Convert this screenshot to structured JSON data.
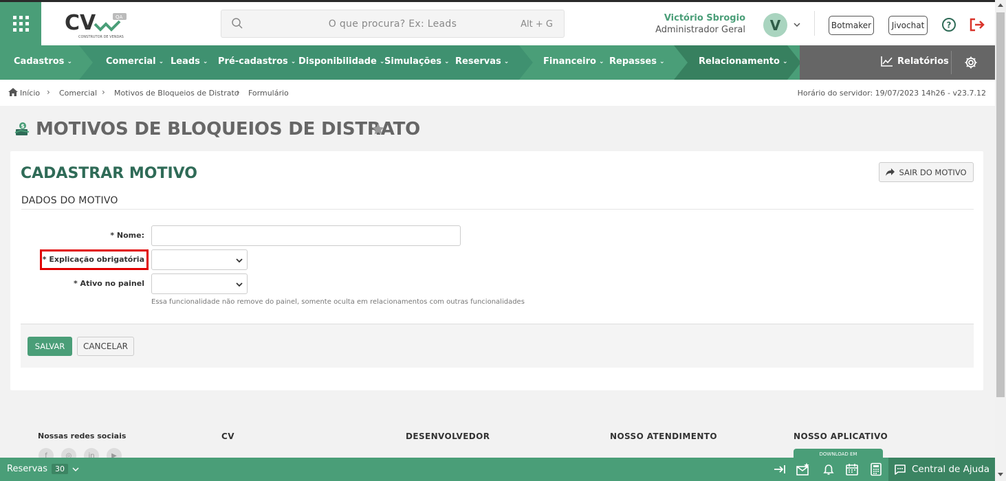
{
  "header": {
    "logo_text": "CV",
    "logo_tag": "QA",
    "logo_sub": "CONSTRUTOR DE VENDAS",
    "search_placeholder": "O que procura? Ex: Leads",
    "search_shortcut": "Alt + G",
    "user_name": "Victório Sbrogio",
    "user_role": "Administrador Geral",
    "avatar_initial": "V",
    "botmaker": "Botmaker",
    "jivochat": "Jivochat"
  },
  "nav": {
    "items": [
      {
        "label": "Cadastros"
      },
      {
        "label": "Comercial"
      },
      {
        "label": "Leads"
      },
      {
        "label": "Pré-cadastros"
      },
      {
        "label": "Disponibilidade"
      },
      {
        "label": "Simulações"
      },
      {
        "label": "Reservas"
      },
      {
        "label": "Financeiro"
      },
      {
        "label": "Repasses"
      },
      {
        "label": "Relacionamento"
      }
    ],
    "reports": "Relatórios",
    "caret": "⌄"
  },
  "breadcrumb": {
    "items": [
      "Início",
      "Comercial",
      "Motivos de Bloqueios de Distrato",
      "Formulário"
    ],
    "server_time": "Horário do servidor: 19/07/2023 14h26 - v23.7.12"
  },
  "page": {
    "title": "MOTIVOS DE BLOQUEIOS DE DISTRATO"
  },
  "form": {
    "card_title": "CADASTRAR MOTIVO",
    "exit_button": "SAIR DO MOTIVO",
    "section_title": "DADOS DO MOTIVO",
    "name_label": "* Nome:",
    "explanation_label": "* Explicação obrigatória",
    "active_label": "* Ativo no painel",
    "active_hint": "Essa funcionalidade não remove do painel, somente oculta em relacionamentos com outras funcionalidades",
    "save_button": "SALVAR",
    "cancel_button": "CANCELAR"
  },
  "footer": {
    "social_title": "Nossas redes sociais",
    "col_cv": "CV",
    "col_dev": "DESENVOLVEDOR",
    "col_support": "NOSSO ATENDIMENTO",
    "col_app": "NOSSO APLICATIVO",
    "app_badge": "DOWNLOAD EM"
  },
  "bottombar": {
    "reservas_label": "Reservas",
    "reservas_count": "30",
    "help_center": "Central de Ajuda"
  },
  "colors": {
    "brand_green": "#4a9e78",
    "dark_green": "#2f6b57",
    "highlight_red": "#e00000"
  }
}
